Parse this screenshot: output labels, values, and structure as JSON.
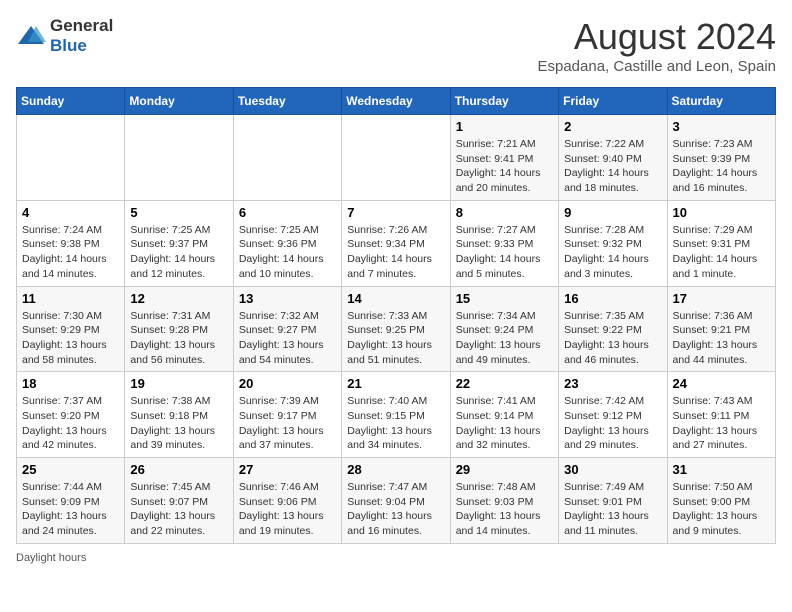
{
  "header": {
    "logo_general": "General",
    "logo_blue": "Blue",
    "title": "August 2024",
    "subtitle": "Espadana, Castille and Leon, Spain"
  },
  "columns": [
    "Sunday",
    "Monday",
    "Tuesday",
    "Wednesday",
    "Thursday",
    "Friday",
    "Saturday"
  ],
  "weeks": [
    [
      {
        "day": "",
        "info": ""
      },
      {
        "day": "",
        "info": ""
      },
      {
        "day": "",
        "info": ""
      },
      {
        "day": "",
        "info": ""
      },
      {
        "day": "1",
        "info": "Sunrise: 7:21 AM\nSunset: 9:41 PM\nDaylight: 14 hours\nand 20 minutes."
      },
      {
        "day": "2",
        "info": "Sunrise: 7:22 AM\nSunset: 9:40 PM\nDaylight: 14 hours\nand 18 minutes."
      },
      {
        "day": "3",
        "info": "Sunrise: 7:23 AM\nSunset: 9:39 PM\nDaylight: 14 hours\nand 16 minutes."
      }
    ],
    [
      {
        "day": "4",
        "info": "Sunrise: 7:24 AM\nSunset: 9:38 PM\nDaylight: 14 hours\nand 14 minutes."
      },
      {
        "day": "5",
        "info": "Sunrise: 7:25 AM\nSunset: 9:37 PM\nDaylight: 14 hours\nand 12 minutes."
      },
      {
        "day": "6",
        "info": "Sunrise: 7:25 AM\nSunset: 9:36 PM\nDaylight: 14 hours\nand 10 minutes."
      },
      {
        "day": "7",
        "info": "Sunrise: 7:26 AM\nSunset: 9:34 PM\nDaylight: 14 hours\nand 7 minutes."
      },
      {
        "day": "8",
        "info": "Sunrise: 7:27 AM\nSunset: 9:33 PM\nDaylight: 14 hours\nand 5 minutes."
      },
      {
        "day": "9",
        "info": "Sunrise: 7:28 AM\nSunset: 9:32 PM\nDaylight: 14 hours\nand 3 minutes."
      },
      {
        "day": "10",
        "info": "Sunrise: 7:29 AM\nSunset: 9:31 PM\nDaylight: 14 hours\nand 1 minute."
      }
    ],
    [
      {
        "day": "11",
        "info": "Sunrise: 7:30 AM\nSunset: 9:29 PM\nDaylight: 13 hours\nand 58 minutes."
      },
      {
        "day": "12",
        "info": "Sunrise: 7:31 AM\nSunset: 9:28 PM\nDaylight: 13 hours\nand 56 minutes."
      },
      {
        "day": "13",
        "info": "Sunrise: 7:32 AM\nSunset: 9:27 PM\nDaylight: 13 hours\nand 54 minutes."
      },
      {
        "day": "14",
        "info": "Sunrise: 7:33 AM\nSunset: 9:25 PM\nDaylight: 13 hours\nand 51 minutes."
      },
      {
        "day": "15",
        "info": "Sunrise: 7:34 AM\nSunset: 9:24 PM\nDaylight: 13 hours\nand 49 minutes."
      },
      {
        "day": "16",
        "info": "Sunrise: 7:35 AM\nSunset: 9:22 PM\nDaylight: 13 hours\nand 46 minutes."
      },
      {
        "day": "17",
        "info": "Sunrise: 7:36 AM\nSunset: 9:21 PM\nDaylight: 13 hours\nand 44 minutes."
      }
    ],
    [
      {
        "day": "18",
        "info": "Sunrise: 7:37 AM\nSunset: 9:20 PM\nDaylight: 13 hours\nand 42 minutes."
      },
      {
        "day": "19",
        "info": "Sunrise: 7:38 AM\nSunset: 9:18 PM\nDaylight: 13 hours\nand 39 minutes."
      },
      {
        "day": "20",
        "info": "Sunrise: 7:39 AM\nSunset: 9:17 PM\nDaylight: 13 hours\nand 37 minutes."
      },
      {
        "day": "21",
        "info": "Sunrise: 7:40 AM\nSunset: 9:15 PM\nDaylight: 13 hours\nand 34 minutes."
      },
      {
        "day": "22",
        "info": "Sunrise: 7:41 AM\nSunset: 9:14 PM\nDaylight: 13 hours\nand 32 minutes."
      },
      {
        "day": "23",
        "info": "Sunrise: 7:42 AM\nSunset: 9:12 PM\nDaylight: 13 hours\nand 29 minutes."
      },
      {
        "day": "24",
        "info": "Sunrise: 7:43 AM\nSunset: 9:11 PM\nDaylight: 13 hours\nand 27 minutes."
      }
    ],
    [
      {
        "day": "25",
        "info": "Sunrise: 7:44 AM\nSunset: 9:09 PM\nDaylight: 13 hours\nand 24 minutes."
      },
      {
        "day": "26",
        "info": "Sunrise: 7:45 AM\nSunset: 9:07 PM\nDaylight: 13 hours\nand 22 minutes."
      },
      {
        "day": "27",
        "info": "Sunrise: 7:46 AM\nSunset: 9:06 PM\nDaylight: 13 hours\nand 19 minutes."
      },
      {
        "day": "28",
        "info": "Sunrise: 7:47 AM\nSunset: 9:04 PM\nDaylight: 13 hours\nand 16 minutes."
      },
      {
        "day": "29",
        "info": "Sunrise: 7:48 AM\nSunset: 9:03 PM\nDaylight: 13 hours\nand 14 minutes."
      },
      {
        "day": "30",
        "info": "Sunrise: 7:49 AM\nSunset: 9:01 PM\nDaylight: 13 hours\nand 11 minutes."
      },
      {
        "day": "31",
        "info": "Sunrise: 7:50 AM\nSunset: 9:00 PM\nDaylight: 13 hours\nand 9 minutes."
      }
    ]
  ],
  "footer": {
    "daylight_label": "Daylight hours"
  }
}
